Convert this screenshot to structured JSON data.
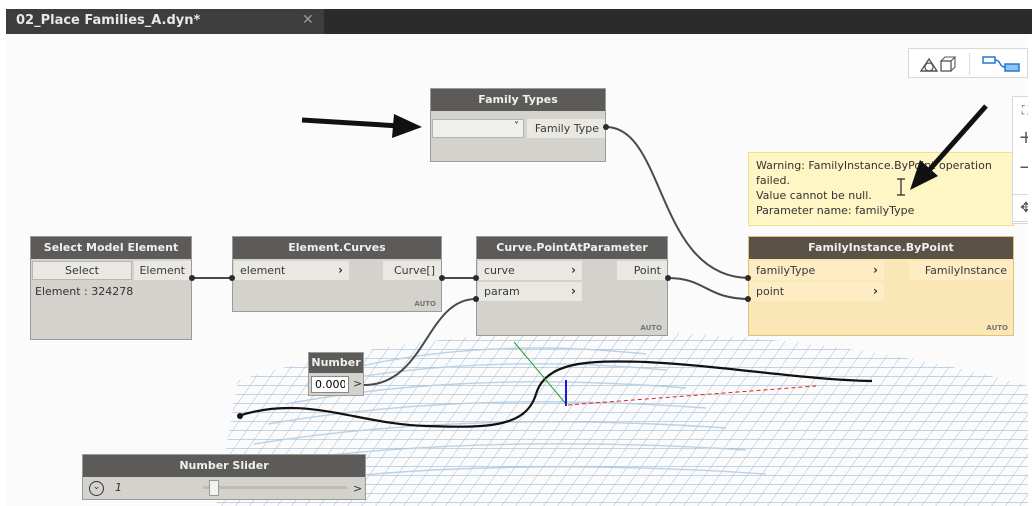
{
  "window": {
    "tab_title": "02_Place Families_A.dyn*",
    "tab_close": "✕"
  },
  "colors": {
    "header": "#5c5b59",
    "node_body": "#d4d2cc",
    "warning_node": "#fbe7b6",
    "warning_bubble": "#fef6c4",
    "wire": "#4a4a4a",
    "selected_point": "#0000cc",
    "guide_line": "#cc0000"
  },
  "view_toolbar": {
    "geometry_icon": "geometry-view-icon",
    "graph_icon": "graph-view-icon"
  },
  "zoom_controls": {
    "fit": "⛶",
    "zoom_in": "+",
    "zoom_out": "−",
    "pan": "✥"
  },
  "nodes": {
    "family_types": {
      "title": "Family Types",
      "dropdown_value": "",
      "dropdown_arrow": "˅",
      "output": "Family Type"
    },
    "select_model_element": {
      "title": "Select Model Element",
      "button_label": "Select",
      "output": "Element",
      "result": "Element : 324278"
    },
    "element_curves": {
      "title": "Element.Curves",
      "input": "element",
      "output": "Curve[]",
      "lacing": "AUTO"
    },
    "curve_point_at_parameter": {
      "title": "Curve.PointAtParameter",
      "input_curve": "curve",
      "input_param": "param",
      "output": "Point",
      "lacing": "AUTO"
    },
    "family_instance_by_point": {
      "title": "FamilyInstance.ByPoint",
      "input_family_type": "familyType",
      "input_point": "point",
      "output": "FamilyInstance",
      "lacing": "AUTO"
    },
    "number": {
      "title": "Number",
      "value": "0.000",
      "output_arrow": ">"
    },
    "number_slider": {
      "title": "Number Slider",
      "value": "1",
      "expand_icon": "⌄",
      "output_arrow": ">"
    }
  },
  "warning": {
    "line1": "Warning: FamilyInstance.ByPoint operation failed.",
    "line2": "Value cannot be null.",
    "line3": "Parameter name: familyType"
  },
  "annotations": {
    "arrow_left": "arrow-pointing-at-dropdown",
    "arrow_right": "arrow-pointing-at-warning"
  }
}
